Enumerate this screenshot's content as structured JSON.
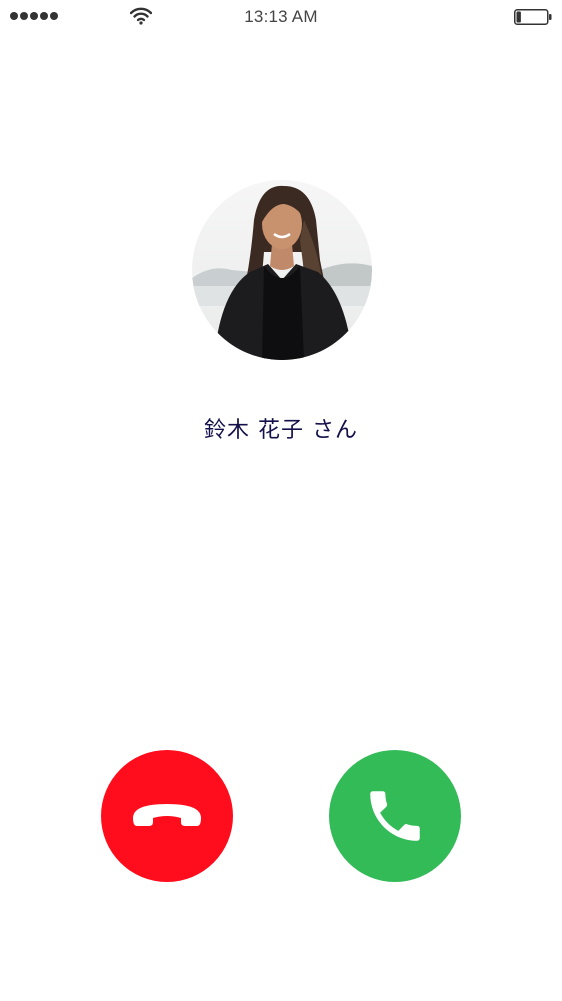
{
  "status_bar": {
    "time": "13:13 AM",
    "signal_icon": "signal-dots-icon",
    "wifi_icon": "wifi-icon",
    "battery_icon": "battery-icon",
    "battery_level": 0.15
  },
  "caller": {
    "name": "鈴木 花子 さん",
    "avatar": "caller-photo"
  },
  "actions": {
    "decline_icon": "hang-up-phone-icon",
    "accept_icon": "phone-icon",
    "decline_color": "#ff0d1c",
    "accept_color": "#33bb58"
  }
}
